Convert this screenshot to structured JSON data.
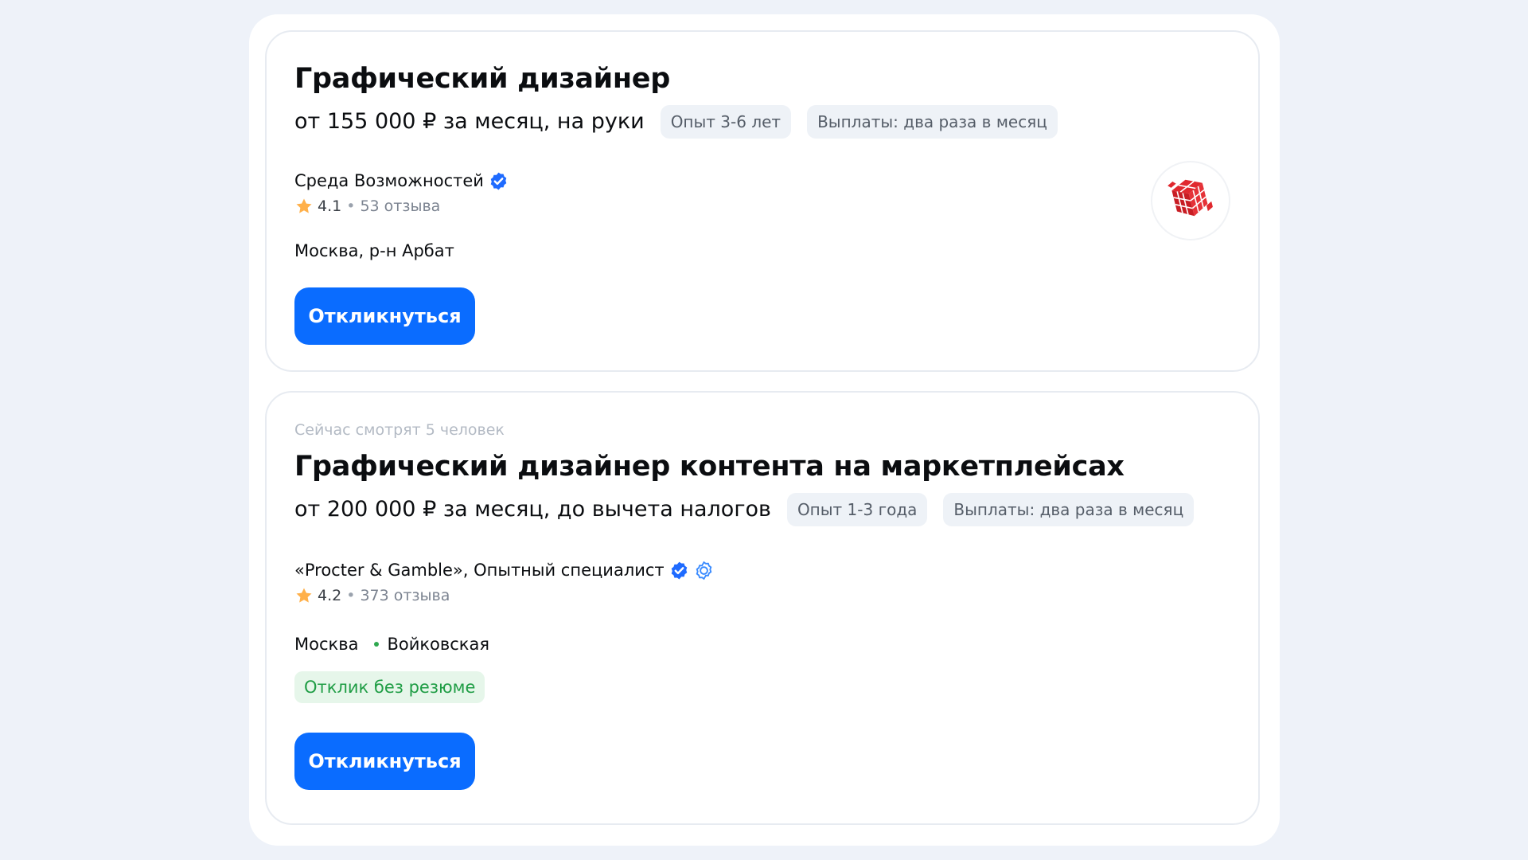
{
  "vacancies": [
    {
      "watching": "",
      "title": "Графический дизайнер",
      "salary": "от 155 000 ₽ за месяц, на руки",
      "chips": [
        "Опыт 3-6 лет",
        "Выплаты: два раза в месяц"
      ],
      "company": "Среда Возможностей",
      "rating": "4.1",
      "reviews": "53 отзыва",
      "city": "Москва, р-н Арбат",
      "metro": "",
      "no_resume": "",
      "apply_label": "Откликнуться",
      "logo_icon": "red-cube-logo-icon"
    },
    {
      "watching": "Сейчас смотрят 5 человек",
      "title": "Графический дизайнер контента на маркетплейсах",
      "salary": "от 200 000 ₽ за месяц, до вычета налогов",
      "chips": [
        "Опыт 1-3 года",
        "Выплаты: два раза в месяц"
      ],
      "company": "«Procter & Gamble», Опытный специалист",
      "rating": "4.2",
      "reviews": "373 отзыва",
      "city": "Москва",
      "metro": "Войковская",
      "no_resume": "Отклик без резюме",
      "apply_label": "Откликнуться"
    }
  ],
  "colors": {
    "accent": "#0a6cff",
    "verified": "#1f6bff",
    "star": "#ffb04a",
    "metro_line": "#2fa84f",
    "no_resume_bg": "#e6f6ea",
    "no_resume_text": "#1f9d45",
    "logo": "#d9252a"
  }
}
